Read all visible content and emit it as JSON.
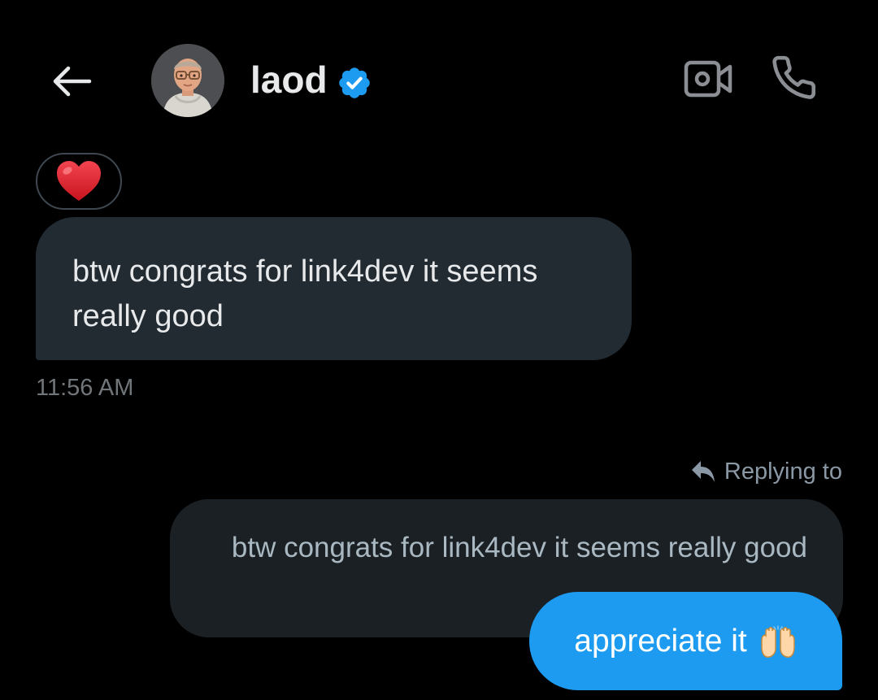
{
  "header": {
    "contact_name": "laod",
    "verified": true,
    "accent_color": "#1d9bf0",
    "icons": [
      "arrow-left-icon",
      "avatar",
      "verified-badge-icon",
      "video-camera-icon",
      "phone-icon"
    ]
  },
  "messages": {
    "received": {
      "reaction": "heart",
      "text": "btw congrats for link4dev it seems really good",
      "time": "11:56 AM"
    },
    "sent": {
      "reply_label": "Replying to",
      "quoted_text": "btw congrats for link4dev it seems really good",
      "text": "appreciate it",
      "emoji": "raising-hands",
      "bubble_color": "#1d9bf0"
    }
  }
}
